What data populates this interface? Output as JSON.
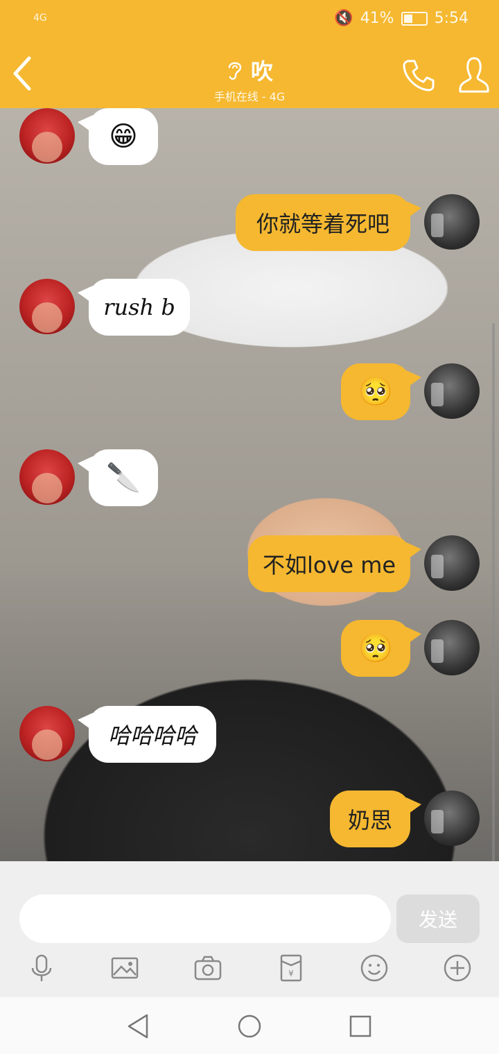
{
  "status_bar": {
    "signal": "4G",
    "battery": "41%",
    "time": "5:54"
  },
  "header": {
    "title": "吹",
    "subtitle": "手机在线 - 4G"
  },
  "messages": [
    {
      "side": "left",
      "type": "emoji",
      "text": "😁"
    },
    {
      "side": "right",
      "type": "text",
      "text": "你就等着死吧"
    },
    {
      "side": "left",
      "type": "text",
      "text": "rush b",
      "style": "handwriting"
    },
    {
      "side": "right",
      "type": "emoji",
      "text": "🥺"
    },
    {
      "side": "left",
      "type": "emoji",
      "text": "🔪"
    },
    {
      "side": "right",
      "type": "text",
      "text": "不如love me"
    },
    {
      "side": "right",
      "type": "emoji",
      "text": "🥺"
    },
    {
      "side": "left",
      "type": "text",
      "text": "哈哈哈哈",
      "style": "handwriting"
    },
    {
      "side": "right",
      "type": "text",
      "text": "奶思"
    }
  ],
  "input": {
    "placeholder": "",
    "send_label": "发送"
  },
  "colors": {
    "accent": "#f5b830",
    "bubble_left": "#ffffff",
    "bubble_right": "#f5b830"
  },
  "icons": {
    "tools": [
      "microphone-icon",
      "image-icon",
      "camera-icon",
      "red-packet-icon",
      "emoji-icon",
      "plus-icon"
    ],
    "nav": [
      "nav-back-icon",
      "nav-home-icon",
      "nav-recents-icon"
    ]
  }
}
